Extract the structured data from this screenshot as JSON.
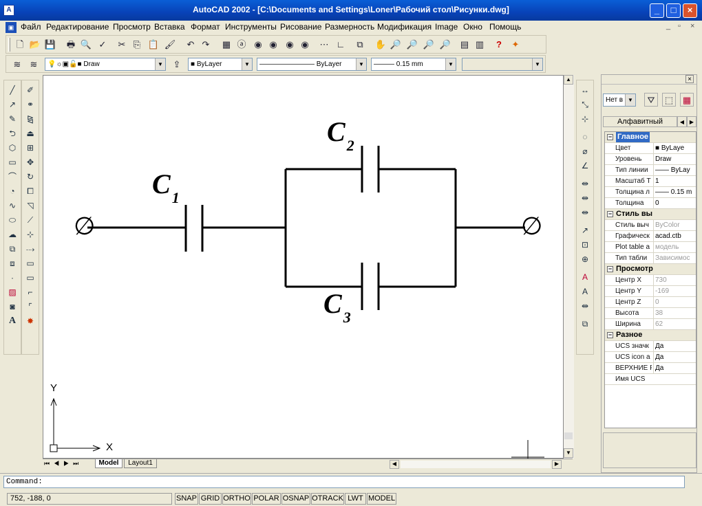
{
  "window": {
    "title": "AutoCAD 2002 - [C:\\Documents and Settings\\Loner\\Рабочий стол\\Рисунки.dwg]",
    "app_icon": "autocad-icon",
    "min_glyph": "_",
    "max_glyph": "□",
    "close_glyph": "×"
  },
  "menu": [
    "Файл",
    "Редактирование",
    "Просмотр",
    "Вставка",
    "Формат",
    "Инструменты",
    "Рисование",
    "Размерность",
    "Модификация",
    "Image",
    "Окно",
    "Помощь"
  ],
  "doc_controls": [
    "_",
    "▫",
    "×"
  ],
  "layers": {
    "current_layer": "Draw",
    "color": "ByLayer",
    "linetype": "ByLayer",
    "lineweight": "0.15 mm",
    "plotstyle": ""
  },
  "drawing": {
    "labels": [
      {
        "letter": "C",
        "sub": "1"
      },
      {
        "letter": "C",
        "sub": "2"
      },
      {
        "letter": "C",
        "sub": "3"
      }
    ],
    "terminal_symbol": "∅",
    "ucs_x": "X",
    "ucs_y": "Y"
  },
  "tabs": {
    "model": "Model",
    "layout": "Layout1"
  },
  "properties": {
    "selection": "Нет в",
    "tab": "Алфавитный",
    "categories": [
      {
        "name": "Главное",
        "rows": [
          {
            "name": "Цвет",
            "value": "■ ByLaye",
            "disabled": false
          },
          {
            "name": "Уровень",
            "value": "Draw",
            "disabled": false
          },
          {
            "name": "Тип линии",
            "value": "—— ByLay",
            "disabled": false
          },
          {
            "name": "Масштаб Т",
            "value": "1",
            "disabled": false
          },
          {
            "name": "Толщина л",
            "value": "—— 0.15 m",
            "disabled": false
          },
          {
            "name": "Толщина",
            "value": "0",
            "disabled": false
          }
        ]
      },
      {
        "name": "Стиль вы",
        "rows": [
          {
            "name": "Стиль выч",
            "value": "ByColor",
            "disabled": true
          },
          {
            "name": "Графическ",
            "value": "acad.ctb",
            "disabled": false
          },
          {
            "name": "Plot table a",
            "value": "модель",
            "disabled": true
          },
          {
            "name": "Тип табли",
            "value": "Зависимос",
            "disabled": true
          }
        ]
      },
      {
        "name": "Просмотр",
        "rows": [
          {
            "name": "Центр X",
            "value": "730",
            "disabled": true
          },
          {
            "name": "Центр Y",
            "value": "-169",
            "disabled": true
          },
          {
            "name": "Центр Z",
            "value": "0",
            "disabled": true
          },
          {
            "name": "Высота",
            "value": "38",
            "disabled": true
          },
          {
            "name": "Ширина",
            "value": "62",
            "disabled": true
          }
        ]
      },
      {
        "name": "Разное",
        "rows": [
          {
            "name": "UCS значк",
            "value": "Да",
            "disabled": false
          },
          {
            "name": "UCS icon a",
            "value": "Да",
            "disabled": false
          },
          {
            "name": "ВЕРХНИЕ Р",
            "value": "Да",
            "disabled": false
          },
          {
            "name": "Имя UCS",
            "value": "",
            "disabled": false
          }
        ]
      }
    ]
  },
  "command": {
    "prompt": "Command:"
  },
  "status": {
    "coords": "752, -188, 0",
    "toggles": [
      "SNAP",
      "GRID",
      "ORTHO",
      "POLAR",
      "OSNAP",
      "OTRACK",
      "LWT",
      "MODEL"
    ]
  }
}
